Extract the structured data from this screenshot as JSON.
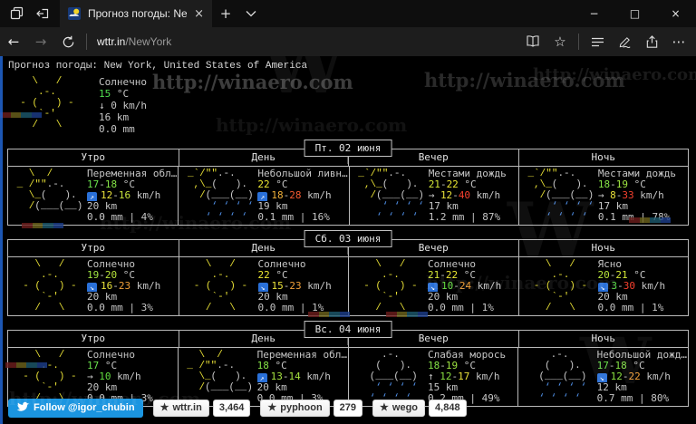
{
  "colors": {
    "page_bg": "#000000",
    "text": "#c6c6c6",
    "border": "#b9b9b9",
    "art_s": "#e6de35",
    "art_c": "#c9c9c9",
    "art_r": "#4f8fe8",
    "wind_emoji_bg": "#2a70d8",
    "twitter_blue": "#1b95e0",
    "edge_accent": "#2165d2"
  },
  "browser": {
    "tab": {
      "title": "Прогноз погоды: New Y",
      "close": "×"
    },
    "new_tab": "+",
    "window_controls": {
      "minimize": "−",
      "maximize": "□",
      "close": "×"
    },
    "nav": {
      "back": "←",
      "forward": "→",
      "url_host": "wttr.in",
      "url_path": "/NewYork",
      "favorites": "☆",
      "more": "⋯"
    }
  },
  "watermark": {
    "text": "http://winaero.com",
    "monogram": "W"
  },
  "page": {
    "header": "Прогноз погоды: New York, United States of America",
    "arts": {
      "sunny": [
        [
          [
            "    \\   /",
            "s"
          ]
        ],
        [
          [
            "     .-.",
            "s"
          ]
        ],
        [
          [
            "  - (   ) -",
            "s"
          ]
        ],
        [
          [
            "     `-'",
            "s"
          ]
        ],
        [
          [
            "    /   \\",
            "s"
          ]
        ]
      ],
      "partly": [
        [
          [
            "   \\  /",
            "s"
          ]
        ],
        [
          [
            " _ /\"\"",
            "s"
          ],
          [
            ".-.",
            "c"
          ]
        ],
        [
          [
            "   \\_",
            "s"
          ],
          [
            "(   ).",
            "c"
          ]
        ],
        [
          [
            "   /",
            "s"
          ],
          [
            "(___(__)",
            "c"
          ]
        ],
        []
      ],
      "shower": [
        [
          [
            " _`/\"\"",
            "s"
          ],
          [
            ".-.",
            "c"
          ]
        ],
        [
          [
            "  ,\\_",
            "s"
          ],
          [
            "(   ).",
            "c"
          ]
        ],
        [
          [
            "   /",
            "s"
          ],
          [
            "(___(__)",
            "c"
          ]
        ],
        [
          [
            "     ‘ ‘ ‘ ‘",
            "r"
          ]
        ],
        [
          [
            "    ‘ ‘ ‘ ‘",
            "r"
          ]
        ]
      ],
      "drizzle": [
        [
          [
            "     .-.",
            "c"
          ]
        ],
        [
          [
            "    (   ).",
            "c"
          ]
        ],
        [
          [
            "   (___(__)",
            "c"
          ]
        ],
        [
          [
            "    ‘ ‘ ‘ ‘",
            "r"
          ]
        ],
        [
          [
            "   ‘ ‘ ‘ ‘",
            "r"
          ]
        ]
      ]
    },
    "current": {
      "art": "sunny",
      "condition": "Солнечно",
      "temp": [
        [
          "15",
          "#50e050"
        ],
        [
          " °C",
          ""
        ]
      ],
      "wind_arrow": "↓",
      "wind_emoji": false,
      "wind": [
        [
          "0 km/h",
          ""
        ]
      ],
      "visibility": "16 km",
      "precip": "0.0 mm"
    },
    "days": [
      {
        "title": "Пт. 02 июня",
        "cells": [
          {
            "period": "Утро",
            "art": "partly",
            "condition": "Переменная обл…",
            "temp": [
              [
                "17",
                "#69e14b"
              ],
              [
                "-",
                ""
              ],
              [
                "18",
                "#84e346"
              ],
              [
                " °C",
                ""
              ]
            ],
            "wind_arrow": "↗",
            "wind_emoji": true,
            "wind": [
              [
                "12",
                "#e9e13a"
              ],
              [
                "-",
                ""
              ],
              [
                "16",
                "#c6e43c"
              ],
              [
                " km/h",
                ""
              ]
            ],
            "visibility": "20 km",
            "precip": "0.0 mm | 4%"
          },
          {
            "period": "День",
            "art": "shower",
            "condition": "Небольшой ливн…",
            "temp": [
              [
                "22",
                "#ede832"
              ],
              [
                " °C",
                ""
              ]
            ],
            "wind_arrow": "↗",
            "wind_emoji": true,
            "wind": [
              [
                "18",
                "#f2b13a"
              ],
              [
                "-",
                ""
              ],
              [
                "28",
                "#f55b31"
              ],
              [
                " km/h",
                ""
              ]
            ],
            "visibility": "19 km",
            "precip": "0.1 mm | 16%"
          },
          {
            "period": "Вечер",
            "art": "shower",
            "condition": "Местами дождь",
            "temp": [
              [
                "21",
                "#d3e737"
              ],
              [
                "-",
                ""
              ],
              [
                "22",
                "#ede832"
              ],
              [
                " °C",
                ""
              ]
            ],
            "wind_arrow": "→",
            "wind_emoji": false,
            "wind": [
              [
                "12",
                "#e9e13a"
              ],
              [
                "-",
                ""
              ],
              [
                "40",
                "#f5402e"
              ],
              [
                " km/h",
                ""
              ]
            ],
            "visibility": "17 km",
            "precip": "1.2 mm | 87%"
          },
          {
            "period": "Ночь",
            "art": "shower",
            "condition": "Местами дождь",
            "temp": [
              [
                "18",
                "#84e346"
              ],
              [
                "-",
                ""
              ],
              [
                "19",
                "#9ee441"
              ],
              [
                " °C",
                ""
              ]
            ],
            "wind_arrow": "→",
            "wind_emoji": false,
            "wind": [
              [
                "8",
                "#e9e13a"
              ],
              [
                "-",
                ""
              ],
              [
                "33",
                "#f5402e"
              ],
              [
                " km/h",
                ""
              ]
            ],
            "visibility": "17 km",
            "precip": "0.1 mm | 78%"
          }
        ]
      },
      {
        "title": "Сб. 03 июня",
        "cells": [
          {
            "period": "Утро",
            "art": "sunny",
            "condition": "Солнечно",
            "temp": [
              [
                "19",
                "#9ee441"
              ],
              [
                "-",
                ""
              ],
              [
                "20",
                "#b8e53c"
              ],
              [
                " °C",
                ""
              ]
            ],
            "wind_arrow": "↘",
            "wind_emoji": true,
            "wind": [
              [
                "16",
                "#e9e13a"
              ],
              [
                "-",
                ""
              ],
              [
                "23",
                "#f2a13a"
              ],
              [
                " km/h",
                ""
              ]
            ],
            "visibility": "20 km",
            "precip": "0.0 mm | 3%"
          },
          {
            "period": "День",
            "art": "sunny",
            "condition": "Солнечно",
            "temp": [
              [
                "22",
                "#ede832"
              ],
              [
                " °C",
                ""
              ]
            ],
            "wind_arrow": "↘",
            "wind_emoji": true,
            "wind": [
              [
                "15",
                "#e9e13a"
              ],
              [
                "-",
                ""
              ],
              [
                "23",
                "#f2a13a"
              ],
              [
                " km/h",
                ""
              ]
            ],
            "visibility": "20 km",
            "precip": "0.0 mm | 1%"
          },
          {
            "period": "Вечер",
            "art": "sunny",
            "condition": "Солнечно",
            "temp": [
              [
                "21",
                "#d3e737"
              ],
              [
                "-",
                ""
              ],
              [
                "22",
                "#ede832"
              ],
              [
                " °C",
                ""
              ]
            ],
            "wind_arrow": "↘",
            "wind_emoji": true,
            "wind": [
              [
                "10",
                "#62dd3e"
              ],
              [
                "-",
                ""
              ],
              [
                "24",
                "#f2a13a"
              ],
              [
                " km/h",
                ""
              ]
            ],
            "visibility": "20 km",
            "precip": "0.0 mm | 1%"
          },
          {
            "period": "Ночь",
            "art": "sunny",
            "condition": "Ясно",
            "temp": [
              [
                "20",
                "#b8e53c"
              ],
              [
                "-",
                ""
              ],
              [
                "21",
                "#d3e737"
              ],
              [
                " °C",
                ""
              ]
            ],
            "wind_arrow": "↘",
            "wind_emoji": true,
            "wind": [
              [
                "3",
                "#4fd63e"
              ],
              [
                "-",
                ""
              ],
              [
                "30",
                "#f5402e"
              ],
              [
                " km/h",
                ""
              ]
            ],
            "visibility": "20 km",
            "precip": "0.0 mm | 1%"
          }
        ]
      },
      {
        "title": "Вс. 04 июня",
        "cells": [
          {
            "period": "Утро",
            "art": "sunny",
            "condition": "Солнечно",
            "temp": [
              [
                "17",
                "#69e14b"
              ],
              [
                " °C",
                ""
              ]
            ],
            "wind_arrow": "→",
            "wind_emoji": false,
            "wind": [
              [
                "10",
                "#62dd3e"
              ],
              [
                " km/h",
                ""
              ]
            ],
            "visibility": "20 km",
            "precip": "0.0 mm | 3%"
          },
          {
            "period": "День",
            "art": "partly",
            "condition": "Переменная обл…",
            "temp": [
              [
                "18",
                "#84e346"
              ],
              [
                " °C",
                ""
              ]
            ],
            "wind_arrow": "↗",
            "wind_emoji": true,
            "wind": [
              [
                "13",
                "#a5e23f"
              ],
              [
                "-",
                ""
              ],
              [
                "14",
                "#a5e23f"
              ],
              [
                " km/h",
                ""
              ]
            ],
            "visibility": "20 km",
            "precip": "0.0 mm | 3%"
          },
          {
            "period": "Вечер",
            "art": "drizzle",
            "condition": "Слабая морось",
            "temp": [
              [
                "18",
                "#84e346"
              ],
              [
                "-",
                ""
              ],
              [
                "19",
                "#9ee441"
              ],
              [
                " °C",
                ""
              ]
            ],
            "wind_arrow": "↑",
            "wind_emoji": false,
            "wind": [
              [
                "12",
                "#8ae040"
              ],
              [
                "-",
                ""
              ],
              [
                "17",
                "#e9e13a"
              ],
              [
                " km/h",
                ""
              ]
            ],
            "visibility": "15 km",
            "precip": "0.2 mm | 49%"
          },
          {
            "period": "Ночь",
            "art": "drizzle",
            "condition": "Небольшой дожд…",
            "temp": [
              [
                "17",
                "#69e14b"
              ],
              [
                "-",
                ""
              ],
              [
                "18",
                "#84e346"
              ],
              [
                " °C",
                ""
              ]
            ],
            "wind_arrow": "↘",
            "wind_emoji": true,
            "wind": [
              [
                "12",
                "#8ae040"
              ],
              [
                "-",
                ""
              ],
              [
                "22",
                "#f2a13a"
              ],
              [
                " km/h",
                ""
              ]
            ],
            "visibility": "12 km",
            "precip": "0.7 mm | 80%"
          }
        ]
      }
    ]
  },
  "footer": {
    "twitter": {
      "label": "Follow @igor_chubin"
    },
    "star_glyph": "★",
    "badges": [
      {
        "label": "wttr.in",
        "count": "3,464"
      },
      {
        "label": "pyphoon",
        "count": "279"
      },
      {
        "label": "wego",
        "count": "4,848"
      }
    ]
  }
}
